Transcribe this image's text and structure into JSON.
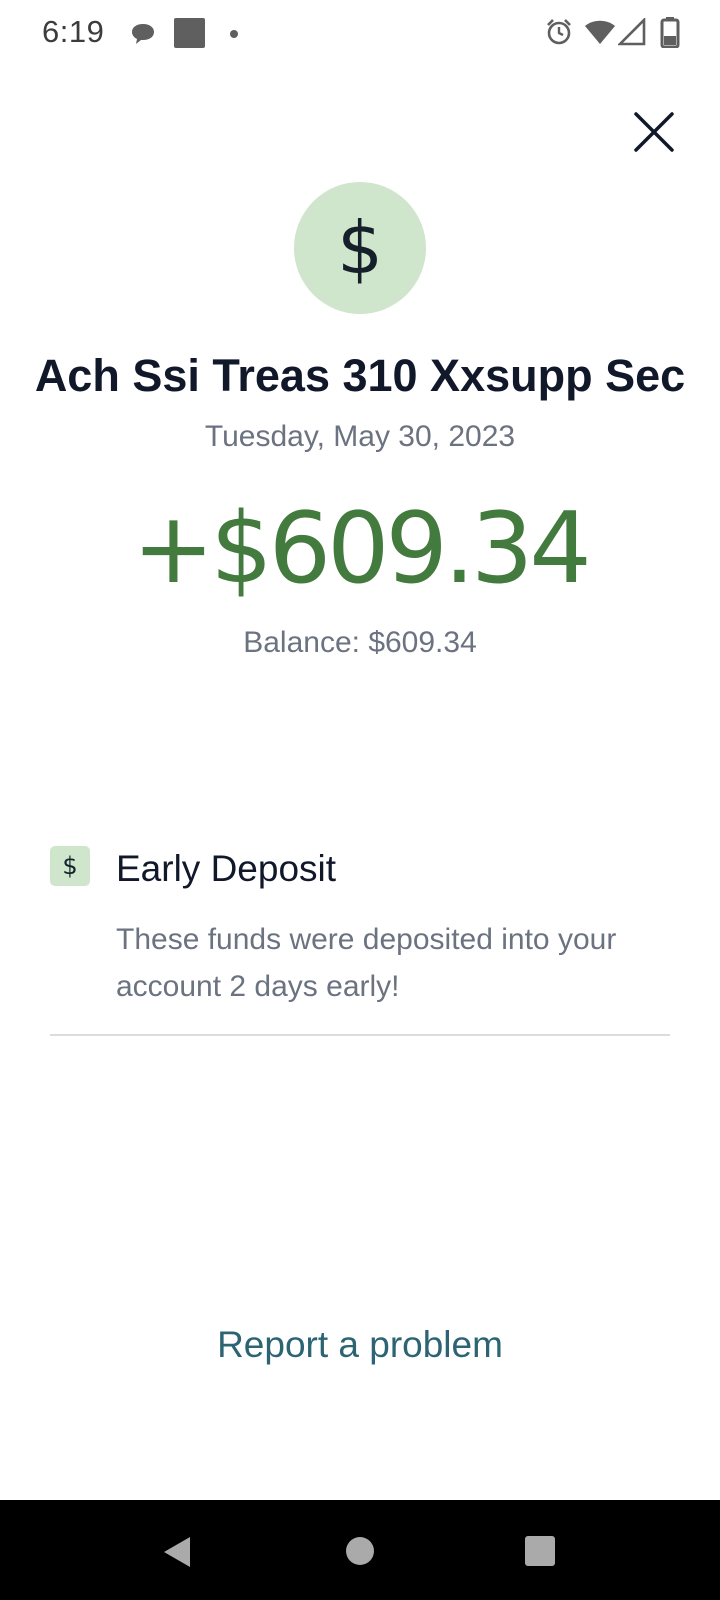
{
  "status_bar": {
    "time": "6:19",
    "icons": [
      "chat-bubble-icon",
      "square-icon",
      "dot-icon",
      "alarm-icon",
      "wifi-icon",
      "signal-icon",
      "battery-icon"
    ]
  },
  "close_icon": "close-icon",
  "avatar_symbol": "$",
  "transaction": {
    "title": "Ach Ssi Treas 310 Xxsupp Sec",
    "date": "Tuesday, May 30, 2023",
    "amount": "+$609.34",
    "balance": "Balance: $609.34"
  },
  "early_deposit": {
    "icon_symbol": "$",
    "title": "Early Deposit",
    "description": "These funds were deposited into your account 2 days early!"
  },
  "report_link": "Report a problem",
  "colors": {
    "accent_green": "#437a3d",
    "avatar_bg": "#cfe5cc",
    "link": "#2d6474"
  },
  "nav_bar": {
    "icons": [
      "back-icon",
      "home-icon",
      "recents-icon"
    ]
  }
}
